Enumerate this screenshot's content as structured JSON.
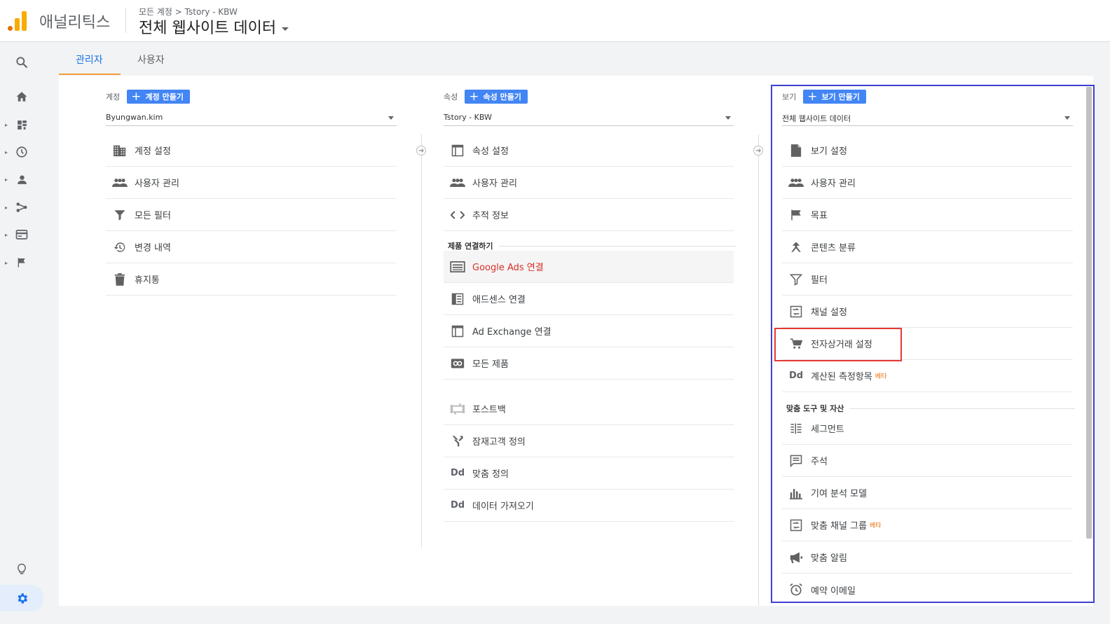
{
  "header": {
    "brand": "애널리틱스",
    "breadcrumb": "모든 계정 > Tstory - KBW",
    "view_title": "전체 웹사이트 데이터"
  },
  "tabs": [
    {
      "label": "관리자",
      "active": true
    },
    {
      "label": "사용자",
      "active": false
    }
  ],
  "account": {
    "label": "계정",
    "create_button": "계정 만들기",
    "selected": "Byungwan.kim",
    "items": [
      {
        "icon": "building-icon",
        "label": "계정 설정"
      },
      {
        "icon": "users-icon",
        "label": "사용자 관리"
      },
      {
        "icon": "filter-icon",
        "label": "모든 필터"
      },
      {
        "icon": "history-icon",
        "label": "변경 내역"
      },
      {
        "icon": "trash-icon",
        "label": "휴지통"
      }
    ]
  },
  "property": {
    "label": "속성",
    "create_button": "속성 만들기",
    "selected": "Tstory - KBW",
    "items": [
      {
        "icon": "property-icon",
        "label": "속성 설정"
      },
      {
        "icon": "users-icon",
        "label": "사용자 관리"
      },
      {
        "icon": "code-icon",
        "label": "추적 정보"
      }
    ],
    "linking_label": "제품 연결하기",
    "linking_items": [
      {
        "icon": "google-ads-icon",
        "label": "Google Ads 연결"
      },
      {
        "icon": "adsense-icon",
        "label": "애드센스 연결"
      },
      {
        "icon": "ad-exchange-icon",
        "label": "Ad Exchange 연결"
      },
      {
        "icon": "link-icon",
        "label": "모든 제품"
      }
    ],
    "other_items": [
      {
        "icon": "postback-icon",
        "label": "포스트백"
      },
      {
        "icon": "audience-icon",
        "label": "잠재고객 정의"
      },
      {
        "icon": "custom-definition-icon",
        "label": "맞춤 정의"
      },
      {
        "icon": "data-import-icon",
        "label": "데이터 가져오기"
      }
    ]
  },
  "view": {
    "label": "보기",
    "create_button": "보기 만들기",
    "selected": "전체 웹사이트 데이터",
    "items": [
      {
        "icon": "document-icon",
        "label": "보기 설정"
      },
      {
        "icon": "users-icon",
        "label": "사용자 관리"
      },
      {
        "icon": "flag-icon",
        "label": "목표"
      },
      {
        "icon": "content-grouping-icon",
        "label": "콘텐츠 분류"
      },
      {
        "icon": "filter-icon",
        "label": "필터"
      },
      {
        "icon": "channel-icon",
        "label": "채널 설정"
      },
      {
        "icon": "cart-icon",
        "label": "전자상거래 설정"
      },
      {
        "icon": "calculated-metrics-icon",
        "label": "계산된 측정항목",
        "badge": "베타"
      }
    ],
    "tools_label": "맞춤 도구 및 자산",
    "tools_items": [
      {
        "icon": "segments-icon",
        "label": "세그먼트"
      },
      {
        "icon": "annotations-icon",
        "label": "주석"
      },
      {
        "icon": "attribution-icon",
        "label": "기여 분석 모델"
      },
      {
        "icon": "channel-icon",
        "label": "맞춤 채널 그룹",
        "badge": "베타"
      },
      {
        "icon": "megaphone-icon",
        "label": "맞춤 알림"
      },
      {
        "icon": "alarm-icon",
        "label": "예약 이메일"
      }
    ]
  },
  "colors": {
    "accent": "#1a73e8",
    "button": "#4285f4",
    "highlight_box": "#e53935",
    "selection_box": "#3f3fd0",
    "tab_underline": "#f29c38"
  }
}
